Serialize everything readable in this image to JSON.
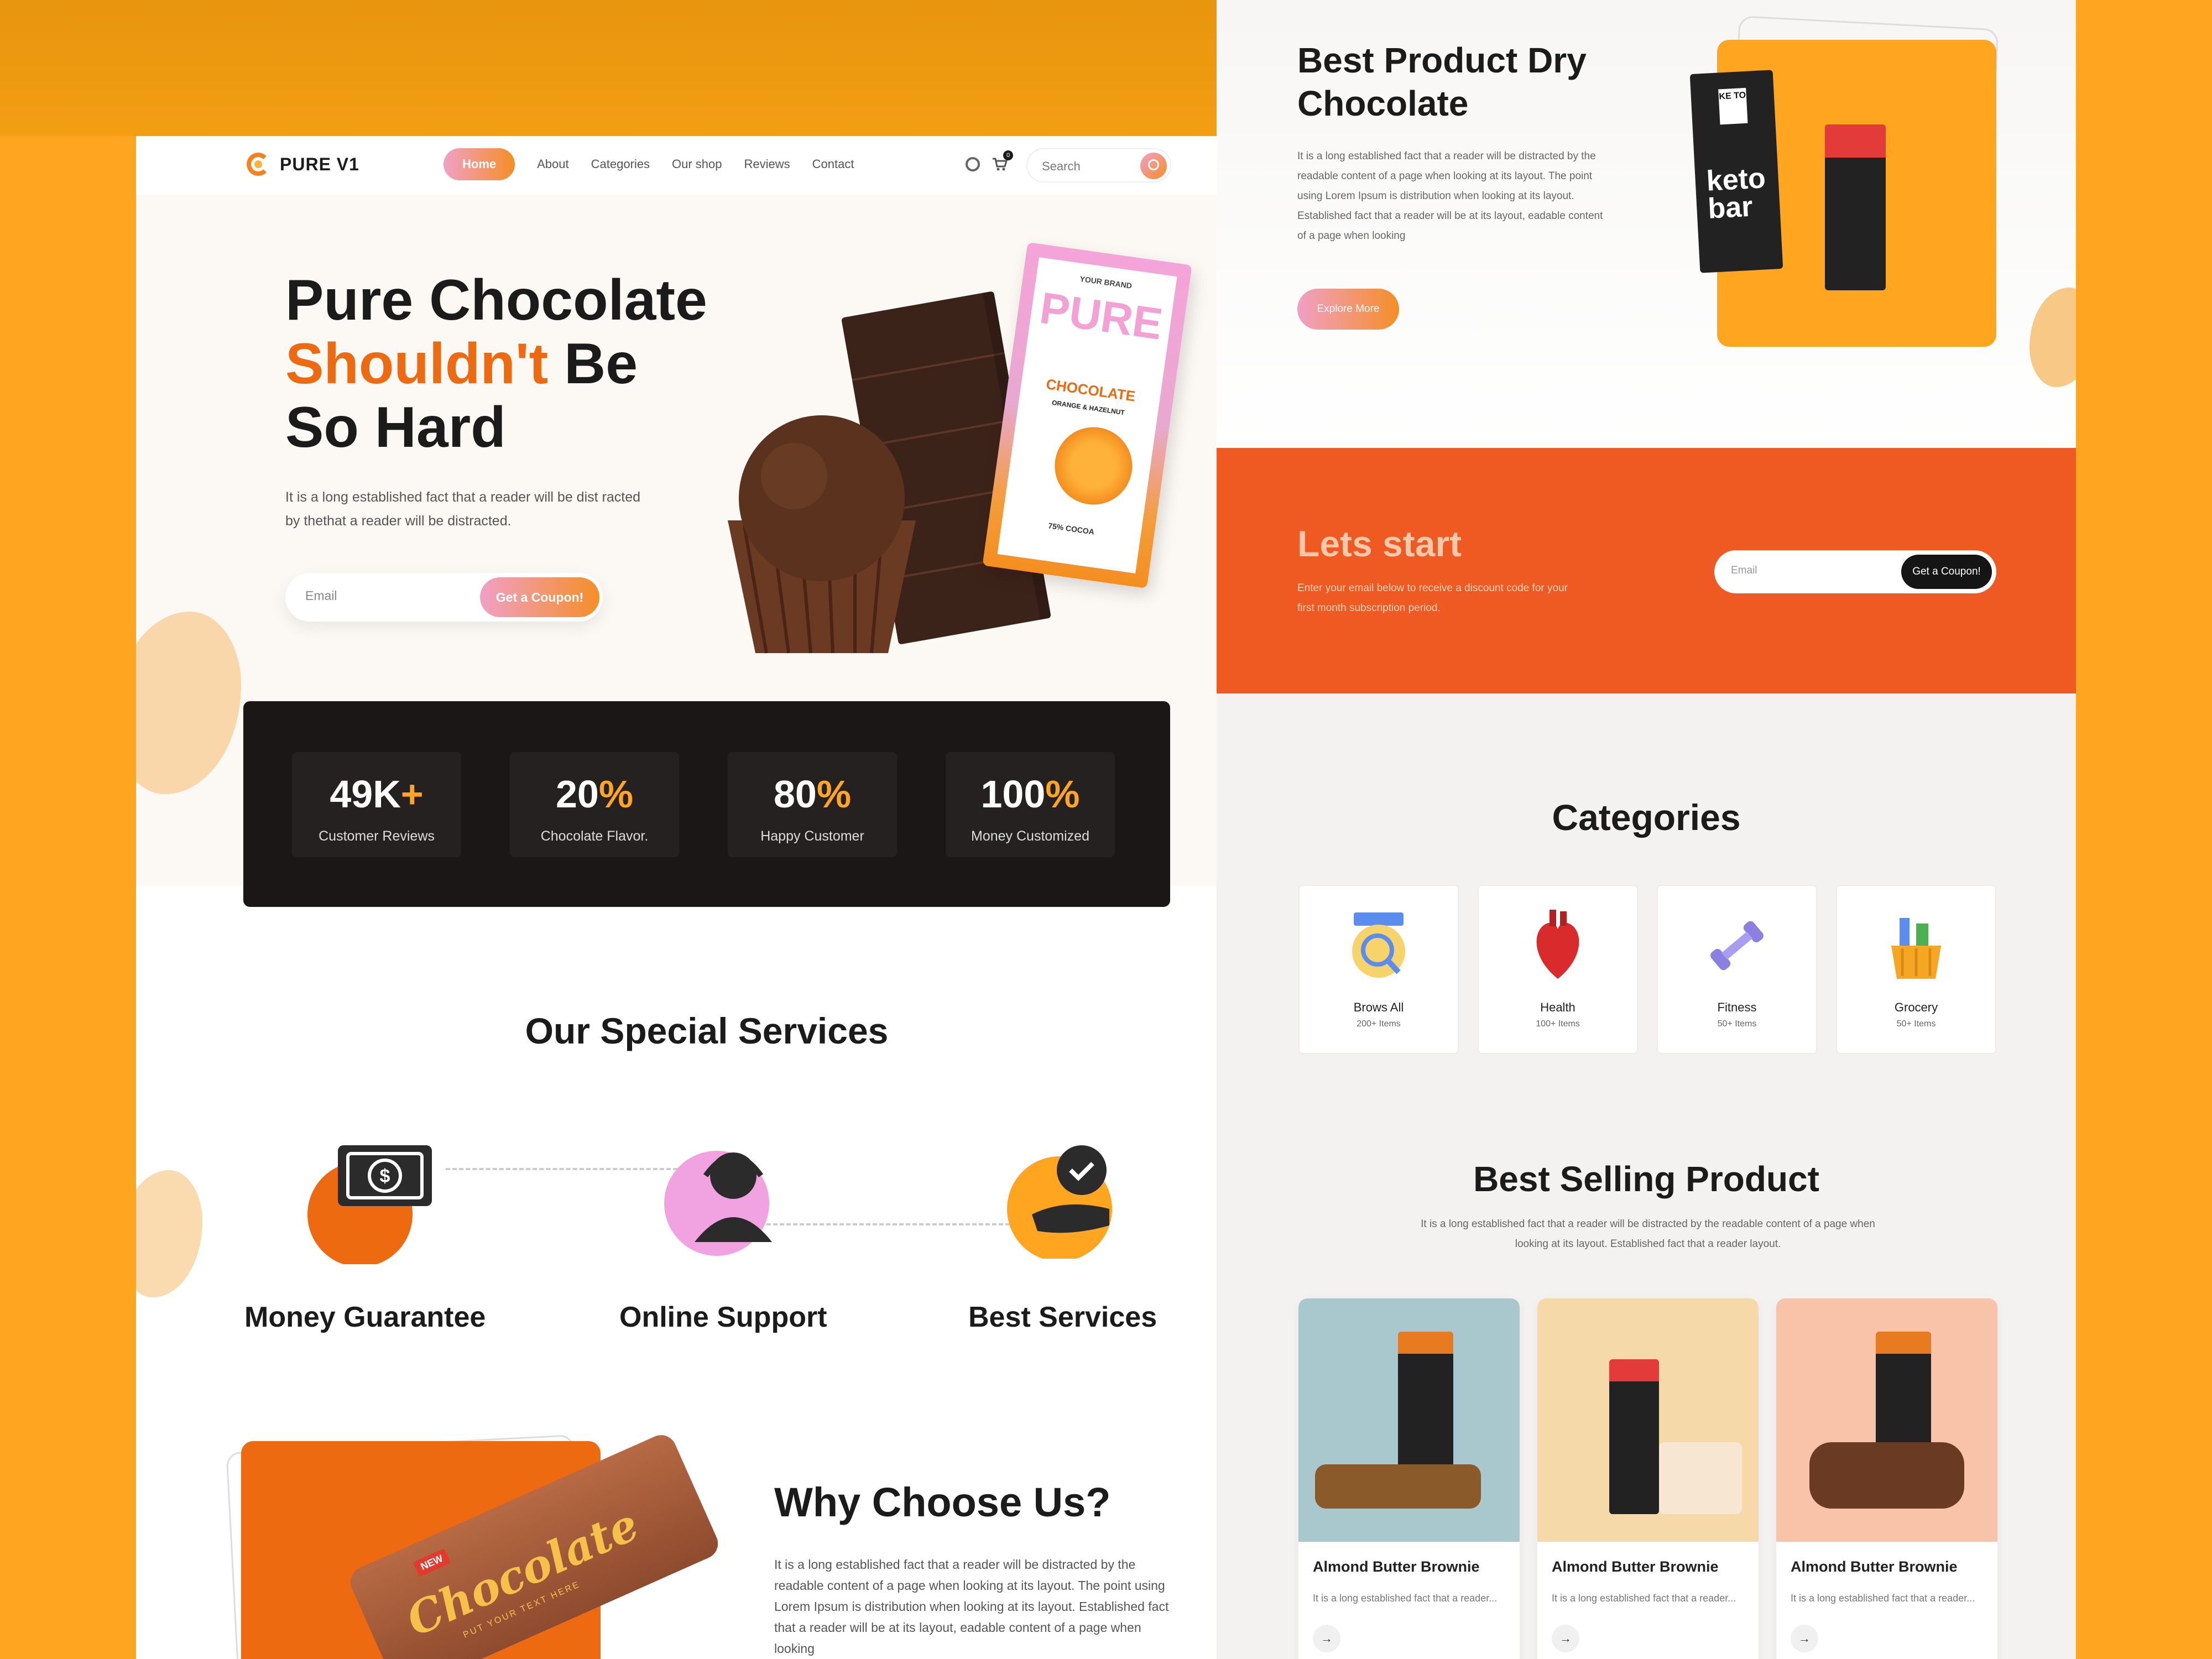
{
  "colors": {
    "background": "#FFA51F",
    "accent_orange": "#EE6A10",
    "dark_panel": "#1A1716",
    "band_orange": "#EE5A22"
  },
  "nav": {
    "logo": "PURE V1",
    "menu": [
      "Home",
      "About",
      "Categories",
      "Our shop",
      "Reviews",
      "Contact"
    ],
    "active": "Home",
    "cart_count": "0",
    "search_placeholder": "Search"
  },
  "hero": {
    "title_line1": "Pure Chocolate",
    "title_highlight": "Shouldn't",
    "title_line2_rest": " Be",
    "title_line3": "So Hard",
    "description": "It is a long established fact that a reader will be dist racted by thethat a reader will be distracted.",
    "email_placeholder": "Email",
    "cta": "Get a Coupon!",
    "pack": {
      "brand": "YOUR BRAND",
      "title": "PURE",
      "subtitle": "CHOCOLATE",
      "flavor": "ORANGE & HAZELNUT",
      "cocoa": "75% COCOA"
    }
  },
  "stats": [
    {
      "value": "49K",
      "suffix": "+",
      "label": "Customer Reviews"
    },
    {
      "value": "20",
      "suffix": "%",
      "label": "Chocolate Flavor."
    },
    {
      "value": "80",
      "suffix": "%",
      "label": "Happy Customer"
    },
    {
      "value": "100",
      "suffix": "%",
      "label": "Money Customized"
    }
  ],
  "services": {
    "title": "Our Special Services",
    "items": [
      {
        "name": "Money Guarantee",
        "icon": "money-icon"
      },
      {
        "name": "Online Support",
        "icon": "headset-icon"
      },
      {
        "name": "Best Services",
        "icon": "award-hand-icon"
      }
    ]
  },
  "why": {
    "title": "Why Choose Us?",
    "description": "It is a long established fact that a reader will be distracted by the readable content of a page when looking at its layout. The point using Lorem Ipsum is distribution when looking at its layout. Established fact that a reader will be  at its layout, eadable content of a page when looking",
    "wrapper_text": "Chocolate",
    "wrapper_new": "NEW",
    "wrapper_tag": "PUT YOUR TEXT HERE"
  },
  "right": {
    "feature": {
      "title": "Best Product Dry Chocolate",
      "description": "It is a long established fact that a reader will be distracted by the readable content of a page when looking at its layout. The point using Lorem Ipsum is distribution when looking at its layout. Established fact that a reader will be  at its layout, eadable content of a page when looking",
      "cta": "Explore More",
      "keto_logo": "KE TO",
      "keto_word": "keto bar"
    },
    "band": {
      "title": "Lets start",
      "description": "Enter your email below to receive a discount code for your first month subscription period.",
      "email_placeholder": "Email",
      "cta": "Get a Coupon!"
    },
    "categories": {
      "title": "Categories",
      "items": [
        {
          "name": "Brows All",
          "count": "200+ Items",
          "icon": "search-list-icon"
        },
        {
          "name": "Health",
          "count": "100+ Items",
          "icon": "heart-organ-icon"
        },
        {
          "name": "Fitness",
          "count": "50+ Items",
          "icon": "dumbbell-icon"
        },
        {
          "name": "Grocery",
          "count": "50+ Items",
          "icon": "grocery-basket-icon"
        }
      ]
    },
    "best": {
      "title": "Best Selling Product",
      "description": "It is a long established fact that a reader will be distracted by the readable content of a page when looking at its layout. Established fact that a reader layout.",
      "products": [
        {
          "name": "Almond Butter Brownie",
          "desc": "It is a long established fact that a reader...",
          "bg": "#A9C8CE"
        },
        {
          "name": "Almond Butter Brownie",
          "desc": "It is a long established fact that a reader...",
          "bg": "#F5D9A8"
        },
        {
          "name": "Almond Butter Brownie",
          "desc": "It is a long established fact that a reader...",
          "bg": "#F8C3A8"
        }
      ]
    }
  }
}
